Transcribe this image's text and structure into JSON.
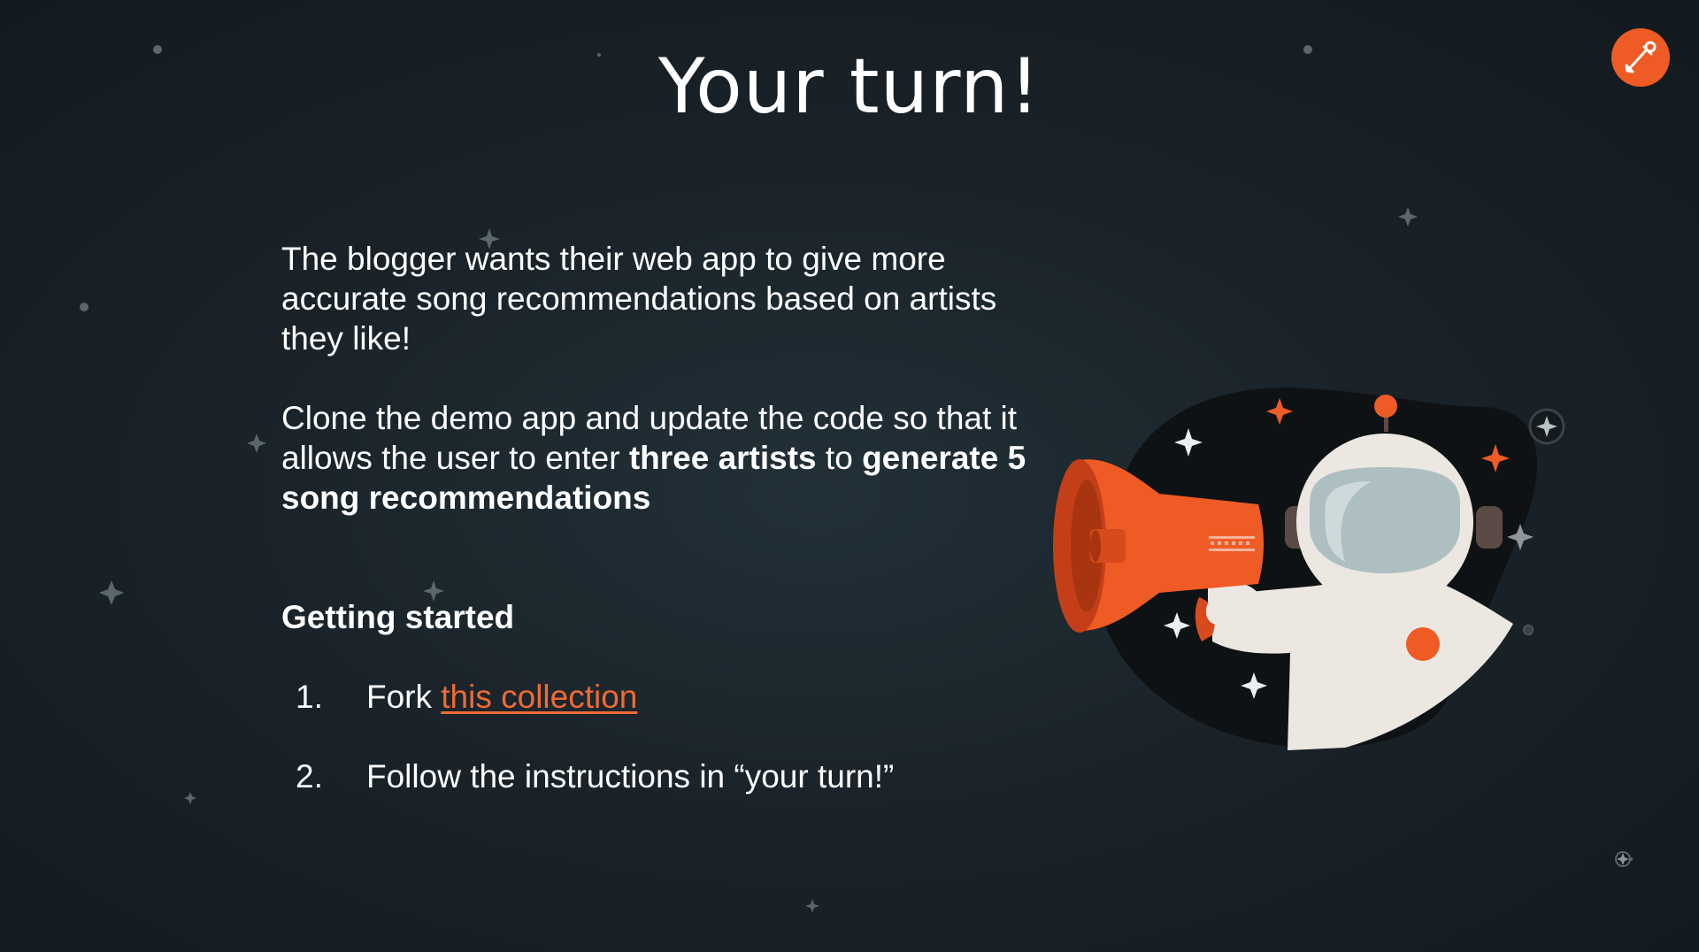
{
  "slide": {
    "title": "Your turn!",
    "logo_icon": "postman-logo-icon",
    "paragraph1": "The blogger wants their web app to give more accurate song recommendations based on artists they like!",
    "paragraph2": {
      "part1": "Clone the demo app and update the code so that it allows the user to enter ",
      "bold1": "three artists",
      "part2": " to ",
      "bold2": "generate 5 song recommendations"
    },
    "getting_started": {
      "heading": "Getting started",
      "steps": [
        {
          "number": "1.",
          "prefix": "Fork ",
          "link": "this collection"
        },
        {
          "number": "2.",
          "text": "Follow the instructions in “your turn!”"
        }
      ]
    },
    "illustration_icon": "astronaut-megaphone-icon"
  },
  "colors": {
    "background": "#1a2329",
    "accent": "#ef5b25",
    "link": "#ef6a35",
    "text": "#ffffff"
  }
}
